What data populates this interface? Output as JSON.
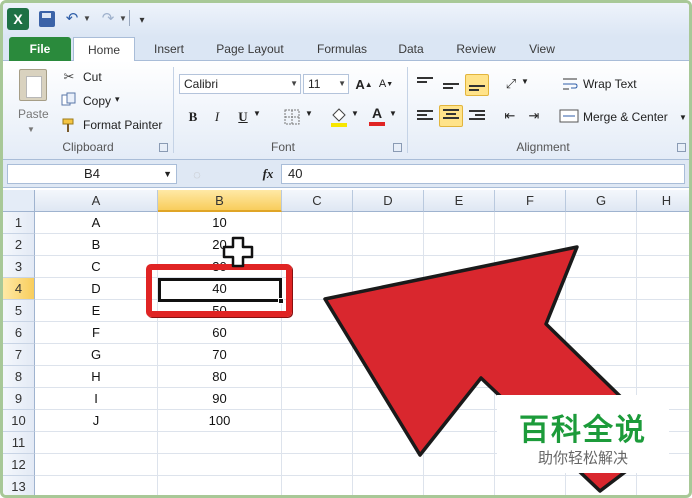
{
  "app": {
    "logo": "X",
    "icons": {
      "logo": "excel-logo-icon",
      "save": "save-icon",
      "undo": "undo-icon",
      "redo": "redo-icon",
      "customize": "customize-qa-icon"
    }
  },
  "tabs": [
    "File",
    "Home",
    "Insert",
    "Page Layout",
    "Formulas",
    "Data",
    "Review",
    "View"
  ],
  "clipboard": {
    "paste": "Paste",
    "cut": "Cut",
    "copy": "Copy",
    "copy_arrow": "▾",
    "format_painter": "Format Painter",
    "label": "Clipboard"
  },
  "font": {
    "name": "Calibri",
    "size": "11",
    "bold": "B",
    "italic": "I",
    "underline": "U",
    "font_color_letter": "A",
    "label": "Font"
  },
  "alignment": {
    "wrap_text": "Wrap Text",
    "merge_center": "Merge & Center",
    "label": "Alignment"
  },
  "formula_bar": {
    "name_box": "B4",
    "fx": "fx",
    "value": "40"
  },
  "columns": [
    "A",
    "B",
    "C",
    "D",
    "E",
    "F",
    "G",
    "H"
  ],
  "selected_column": "B",
  "rows": [
    {
      "num": "1",
      "a": "A",
      "b": "10"
    },
    {
      "num": "2",
      "a": "B",
      "b": "20"
    },
    {
      "num": "3",
      "a": "C",
      "b": "30"
    },
    {
      "num": "4",
      "a": "D",
      "b": "40"
    },
    {
      "num": "5",
      "a": "E",
      "b": "50"
    },
    {
      "num": "6",
      "a": "F",
      "b": "60"
    },
    {
      "num": "7",
      "a": "G",
      "b": "70"
    },
    {
      "num": "8",
      "a": "H",
      "b": "80"
    },
    {
      "num": "9",
      "a": "I",
      "b": "90"
    },
    {
      "num": "10",
      "a": "J",
      "b": "100"
    },
    {
      "num": "11",
      "a": "",
      "b": ""
    },
    {
      "num": "12",
      "a": "",
      "b": ""
    },
    {
      "num": "13",
      "a": "",
      "b": ""
    }
  ],
  "selected_row": "4",
  "annotation": {
    "highlight_color": "#e02424",
    "arrow_color": "#e02424"
  },
  "watermark": {
    "title": "百科全说",
    "subtitle": "助你轻松解决",
    "color": "#1c9b3a"
  }
}
